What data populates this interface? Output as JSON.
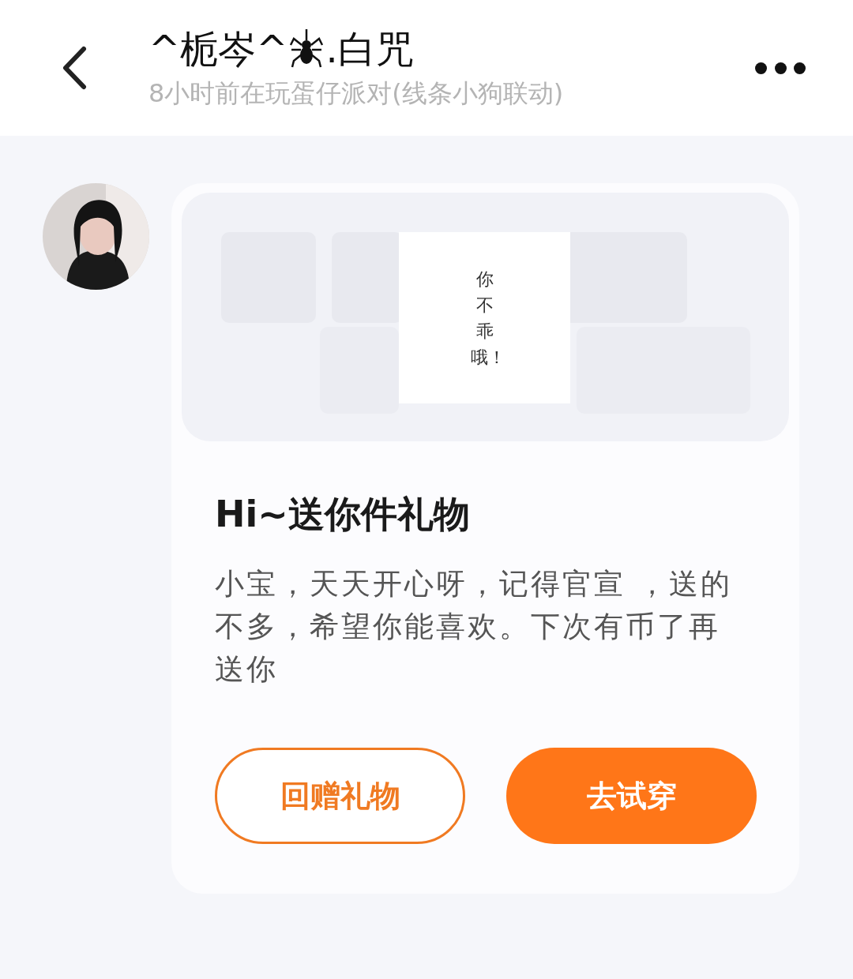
{
  "header": {
    "name_before_icon": "^栀岑^",
    "name_after_icon": ".白咒",
    "status": "8小时前在玩蛋仔派对(线条小狗联动)"
  },
  "message": {
    "gift_image": {
      "kind": "picture",
      "note": "你不乖哦！"
    },
    "title": "Hi~送你件礼物",
    "body": "小宝，天天开心呀，记得官宣 ，送的不多，希望你能喜欢。下次有币了再送你",
    "buttons": [
      {
        "label": "回赠礼物",
        "kind": "outline"
      },
      {
        "label": "去试穿",
        "kind": "filled"
      }
    ]
  }
}
